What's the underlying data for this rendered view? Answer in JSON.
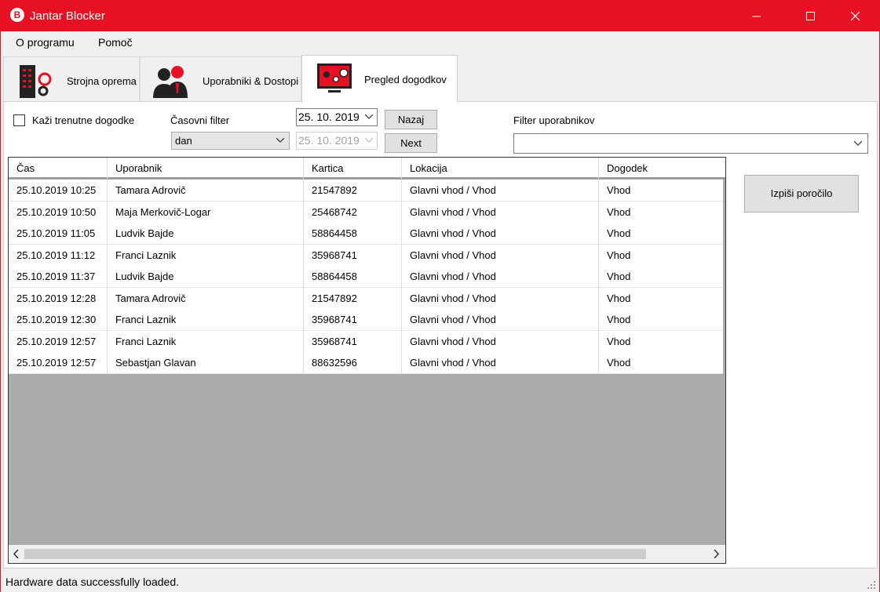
{
  "window": {
    "title": "Jantar Blocker",
    "app_icon": "B",
    "accent": "#e81123"
  },
  "menu": {
    "items": [
      "O programu",
      "Pomoč"
    ]
  },
  "tabs": [
    {
      "label": "Strojna oprema",
      "icon": "server-gear-icon"
    },
    {
      "label": "Uporabniki & Dostopi",
      "icon": "users-icon"
    },
    {
      "label": "Pregled dogodkov",
      "icon": "monitor-events-icon",
      "active": true
    }
  ],
  "controls": {
    "show_current_label": "Kaži trenutne dogodke",
    "show_current_checked": false,
    "time_filter_label": "Časovni filter",
    "time_filter_value": "dan",
    "date_from": "25. 10. 2019",
    "date_to": "25. 10. 2019",
    "back_label": "Nazaj",
    "next_label": "Next",
    "user_filter_label": "Filter uporabnikov",
    "user_filter_value": "",
    "report_label": "Izpiši poročilo"
  },
  "grid": {
    "columns": [
      "Čas",
      "Uporabnik",
      "Kartica",
      "Lokacija",
      "Dogodek"
    ],
    "rows": [
      [
        "25.10.2019 10:25",
        "Tamara Adrovič",
        "21547892",
        "Glavni vhod / Vhod",
        "Vhod"
      ],
      [
        "25.10.2019 10:50",
        "Maja Merkovič-Logar",
        "25468742",
        "Glavni vhod / Vhod",
        "Vhod"
      ],
      [
        "25.10.2019 11:05",
        "Ludvik Bajde",
        "58864458",
        "Glavni vhod / Vhod",
        "Vhod"
      ],
      [
        "25.10.2019 11:12",
        "Franci Laznik",
        "35968741",
        "Glavni vhod / Vhod",
        "Vhod"
      ],
      [
        "25.10.2019 11:37",
        "Ludvik Bajde",
        "58864458",
        "Glavni vhod / Vhod",
        "Vhod"
      ],
      [
        "25.10.2019 12:28",
        "Tamara Adrovič",
        "21547892",
        "Glavni vhod / Vhod",
        "Vhod"
      ],
      [
        "25.10.2019 12:30",
        "Franci Laznik",
        "35968741",
        "Glavni vhod / Vhod",
        "Vhod"
      ],
      [
        "25.10.2019 12:57",
        "Franci Laznik",
        "35968741",
        "Glavni vhod / Vhod",
        "Vhod"
      ],
      [
        "25.10.2019 12:57",
        "Sebastjan Glavan",
        "88632596",
        "Glavni vhod / Vhod",
        "Vhod"
      ]
    ]
  },
  "status": {
    "text": "Hardware data successfully loaded."
  }
}
